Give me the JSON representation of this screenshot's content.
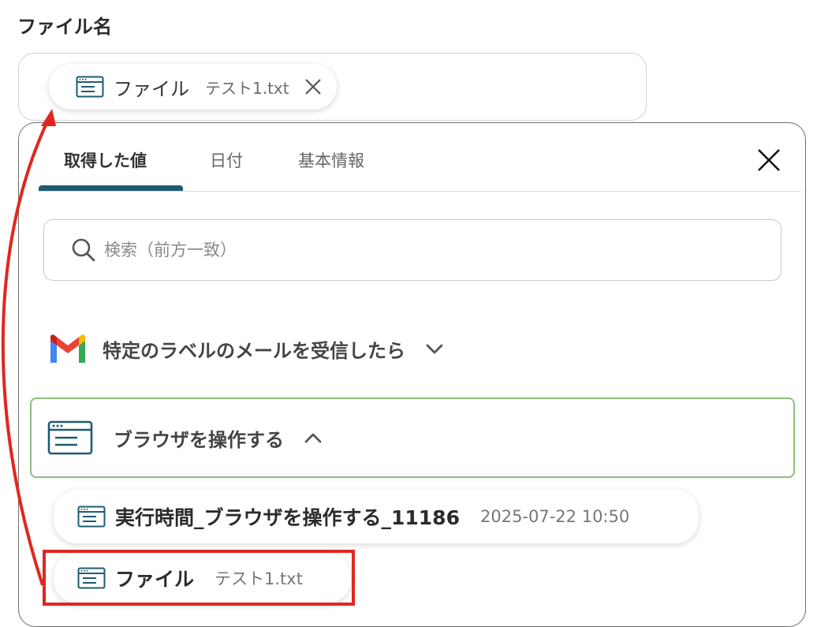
{
  "field": {
    "label": "ファイル名",
    "selected_chip": {
      "name": "ファイル",
      "value": "テスト1.txt"
    }
  },
  "panel": {
    "tabs": [
      {
        "label": "取得した値",
        "active": true
      },
      {
        "label": "日付",
        "active": false
      },
      {
        "label": "基本情報",
        "active": false
      }
    ],
    "search": {
      "placeholder": "検索（前方一致）",
      "value": ""
    },
    "sections": [
      {
        "title": "特定のラベルのメールを受信したら",
        "icon": "gmail-icon",
        "expanded": false
      },
      {
        "title": "ブラウザを操作する",
        "icon": "browser-window-icon",
        "expanded": true
      }
    ],
    "items": [
      {
        "name": "実行時間_ブラウザを操作する_11186",
        "value": "2025-07-22 10:50"
      },
      {
        "name": "ファイル",
        "value": "テスト1.txt"
      }
    ]
  },
  "colors": {
    "accent_tab": "#1e5c72",
    "section_highlight": "#8cc07a",
    "annotation_red": "#e0271f"
  }
}
